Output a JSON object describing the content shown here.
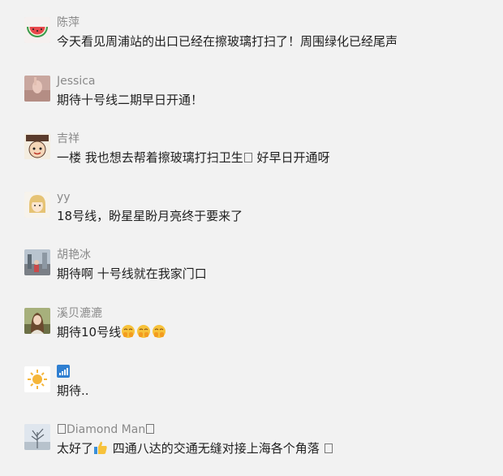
{
  "comments": [
    {
      "name": "陈萍",
      "text": "今天看见周浦站的出口已经在擦玻璃打扫了！周围绿化已经尾声",
      "avatar_icon": "watermelon-icon"
    },
    {
      "name": "Jessica",
      "text": "期待十号线二期早日开通！",
      "avatar_icon": "hand-photo-icon"
    },
    {
      "name": "吉祥",
      "text_before": "一楼 我也想去帮着擦玻璃打扫卫生",
      "text_after": " 好早日开通呀",
      "avatar_icon": "cartoon-sticker-icon"
    },
    {
      "name": "yy",
      "text": "18号线，盼星星盼月亮终于要来了",
      "avatar_icon": "cartoon-girl-icon"
    },
    {
      "name": "胡艳冰",
      "text": "期待啊 十号线就在我家门口",
      "avatar_icon": "street-photo-icon"
    },
    {
      "name": "溪贝漉漉",
      "text": "期待10号线",
      "emoji": [
        "blessed-emoji",
        "blessed-emoji",
        "blessed-emoji"
      ],
      "avatar_icon": "woman-photo-icon"
    },
    {
      "name_icon": "signal-bars-icon",
      "text": "期待..",
      "avatar_icon": "sun-icon"
    },
    {
      "name": "Diamond Man",
      "text_before": "太好了",
      "thumb": "thumbs-up-icon",
      "text_after": " 四通八达的交通无缝对接上海各个角落 ",
      "avatar_icon": "winter-tree-icon"
    }
  ],
  "colors": {
    "background": "#f2f2f2",
    "name": "#8a8a8a",
    "text": "#1f1f1f"
  }
}
